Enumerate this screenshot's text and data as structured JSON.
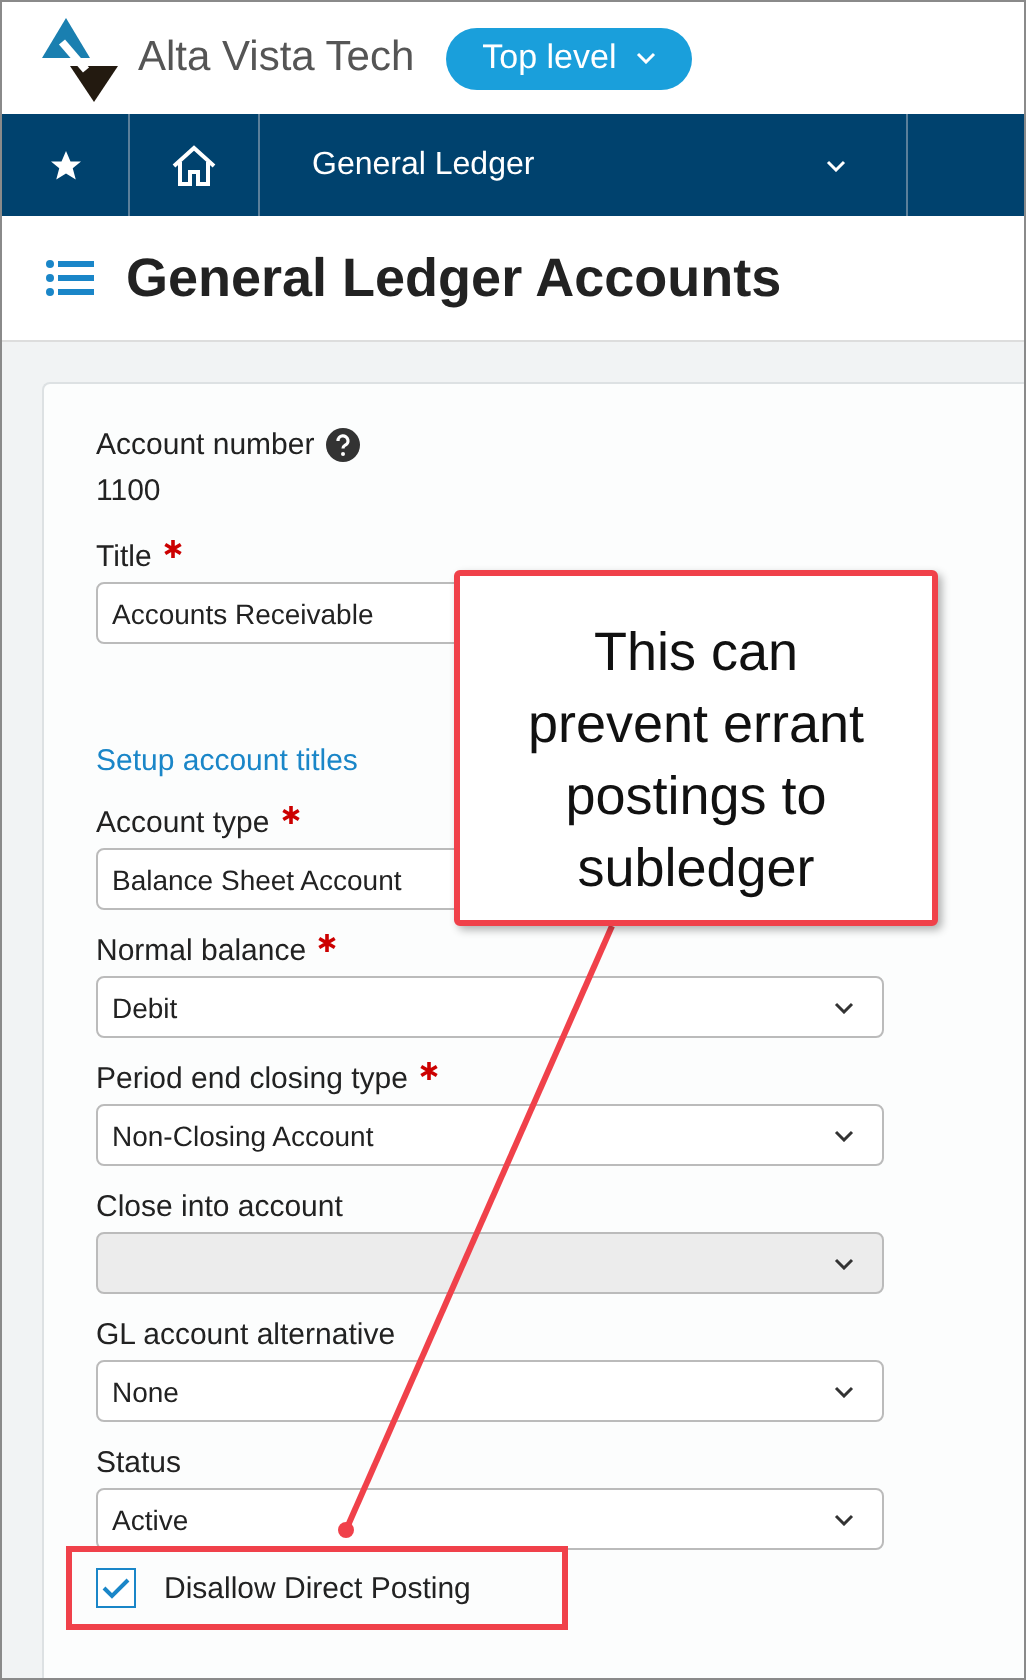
{
  "header": {
    "brand": "Alta Vista Tech",
    "level_button": {
      "label": "Top level"
    }
  },
  "nav": {
    "module": "General Ledger"
  },
  "page_title": "General Ledger Accounts",
  "account_number": {
    "label": "Account number",
    "value": "1100"
  },
  "fields": [
    {
      "kind": "text",
      "label": "Title",
      "required": true,
      "value": "Accounts Receivable",
      "disabled": false
    },
    {
      "kind": "link",
      "label": "Setup account titles"
    },
    {
      "kind": "select",
      "label": "Account type",
      "required": true,
      "value": "Balance Sheet Account",
      "disabled": false
    },
    {
      "kind": "select",
      "label": "Normal balance",
      "required": true,
      "value": "Debit",
      "disabled": false
    },
    {
      "kind": "select",
      "label": "Period end closing type",
      "required": true,
      "value": "Non-Closing Account",
      "disabled": false
    },
    {
      "kind": "select",
      "label": "Close into account",
      "required": false,
      "disabled": true
    },
    {
      "kind": "select",
      "label": "GL account alternative",
      "required": false,
      "value": "None",
      "disabled": false
    },
    {
      "kind": "select",
      "label": "Status",
      "required": false,
      "value": "Active",
      "disabled": false
    }
  ],
  "checkbox": {
    "label": "Disallow Direct Posting",
    "checked": true
  },
  "callout": {
    "text": "This can prevent errant postings to subledger"
  }
}
